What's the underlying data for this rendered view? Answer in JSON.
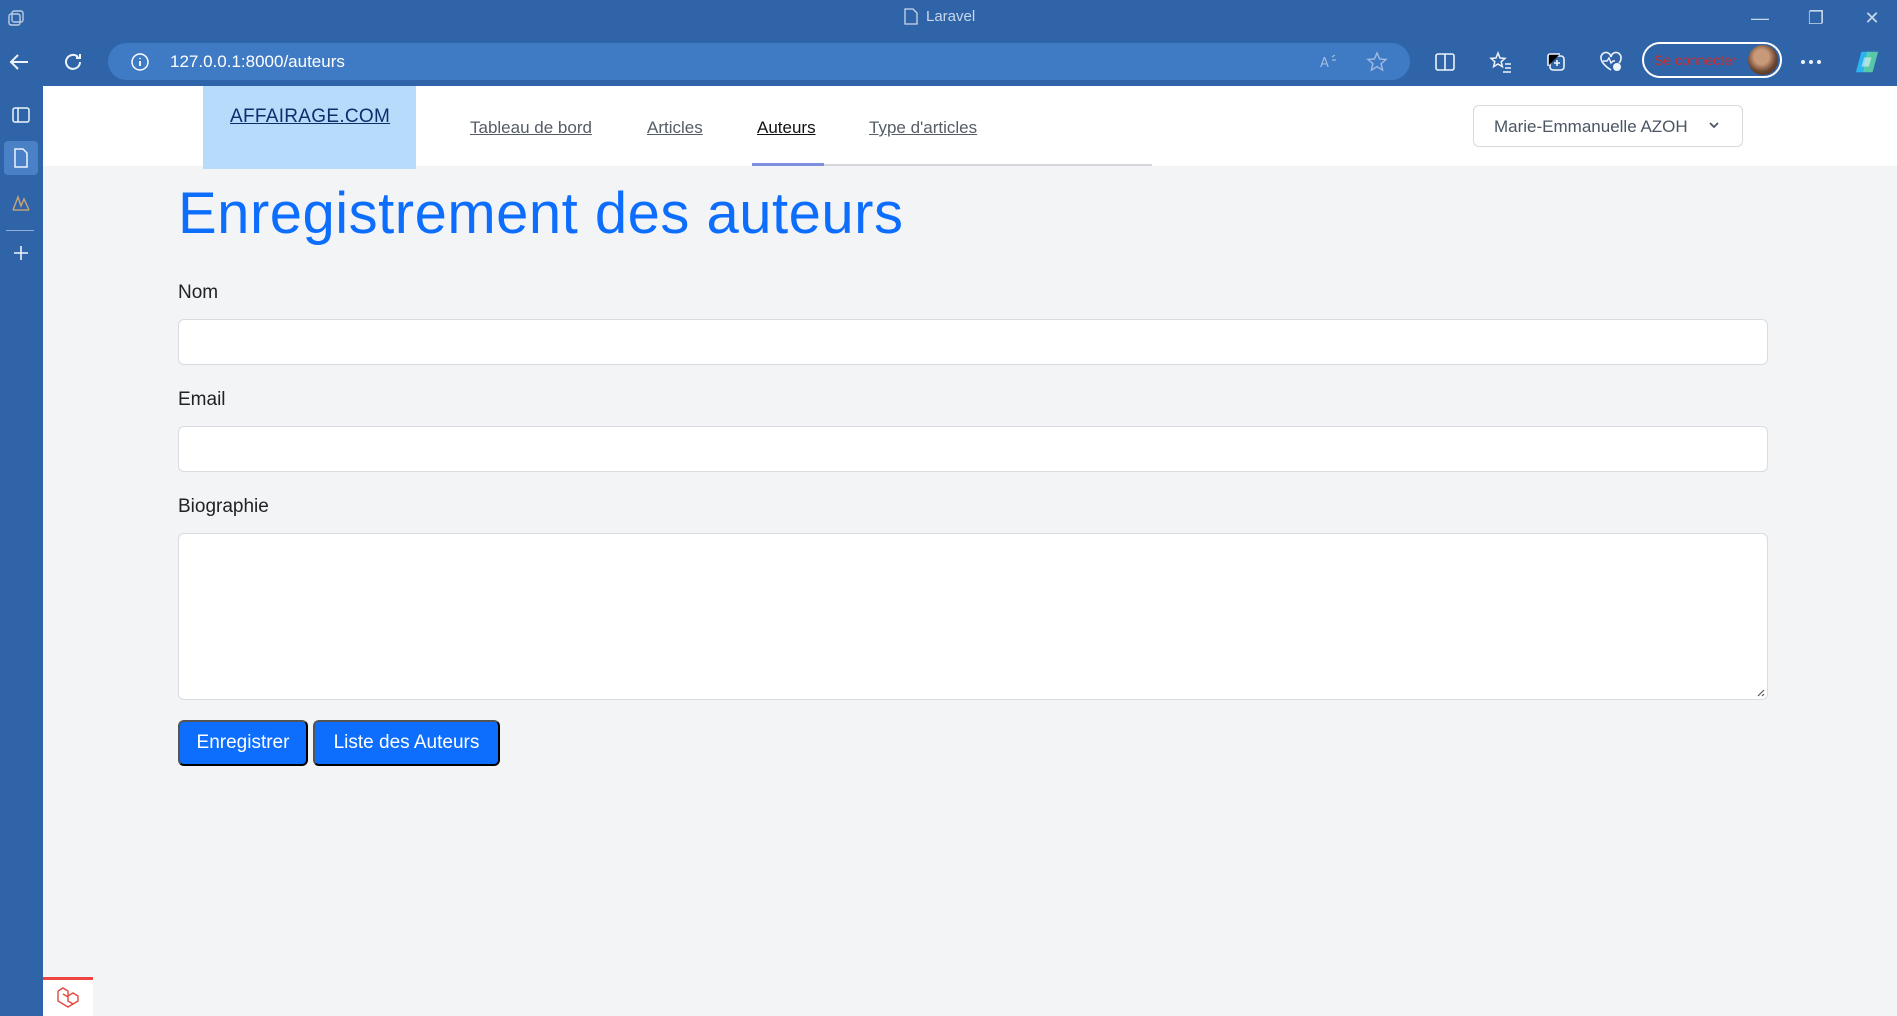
{
  "browser": {
    "tab_title": "Laravel",
    "url": "127.0.0.1:8000/auteurs",
    "signin_label": "Se connecter"
  },
  "navbar": {
    "brand": "AFFAIRAGE.COM",
    "links": [
      {
        "label": "Tableau de bord",
        "active": false
      },
      {
        "label": "Articles",
        "active": false
      },
      {
        "label": "Auteurs",
        "active": true
      },
      {
        "label": "Type d'articles",
        "active": false
      }
    ],
    "user_name": "Marie-Emmanuelle AZOH"
  },
  "form": {
    "title": "Enregistrement des auteurs",
    "fields": [
      {
        "label": "Nom",
        "value": ""
      },
      {
        "label": "Email",
        "value": ""
      },
      {
        "label": "Biographie",
        "value": ""
      }
    ],
    "buttons": {
      "submit": "Enregistrer",
      "list": "Liste des Auteurs"
    }
  },
  "colors": {
    "chrome": "#2f64a8",
    "primary": "#0d6efd",
    "brand_bg": "#b6dbfb"
  }
}
